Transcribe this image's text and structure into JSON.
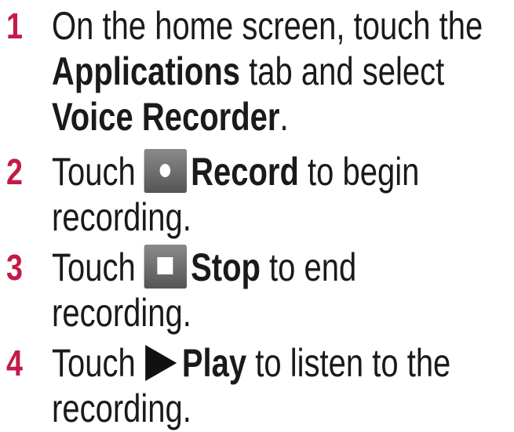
{
  "steps": [
    {
      "number": "1",
      "line1": "On the home screen, touch the",
      "line2_bold": "Applications",
      "line2_rest": " tab and select",
      "line3_bold": "Voice Recorder",
      "line3_rest": "."
    },
    {
      "number": "2",
      "before": "Touch ",
      "icon": "record-icon",
      "bold": "Record",
      "after": " to begin",
      "line2": "recording."
    },
    {
      "number": "3",
      "before": "Touch ",
      "icon": "stop-icon",
      "bold": "Stop",
      "after": " to end",
      "line2": "recording."
    },
    {
      "number": "4",
      "before": "Touch ",
      "icon": "play-icon",
      "bold": "Play",
      "after": " to listen to the",
      "line2": "recording."
    }
  ]
}
